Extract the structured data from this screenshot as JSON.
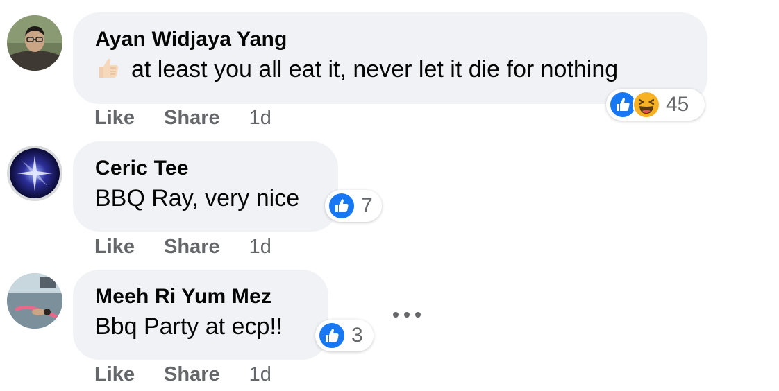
{
  "comments": [
    {
      "author": "Ayan Widjaya Yang",
      "text": "at least you all eat it, never let it die for nothing",
      "emoji": "thumbs-up-emoji",
      "reactions": [
        "like-reaction-icon",
        "haha-reaction-icon"
      ],
      "reaction_count": "45",
      "like_label": "Like",
      "share_label": "Share",
      "time": "1d"
    },
    {
      "author": "Ceric Tee",
      "text": "BBQ Ray, very nice",
      "reactions": [
        "like-reaction-icon"
      ],
      "reaction_count": "7",
      "like_label": "Like",
      "share_label": "Share",
      "time": "1d"
    },
    {
      "author": "Meeh Ri Yum Mez",
      "text": "Bbq Party at ecp!!",
      "reactions": [
        "like-reaction-icon"
      ],
      "reaction_count": "3",
      "like_label": "Like",
      "share_label": "Share",
      "time": "1d"
    }
  ],
  "colors": {
    "bubble": "#f0f2f5",
    "secondary_text": "#65676b",
    "like_blue": "#1877f2",
    "haha_yellow": "#f7b125"
  }
}
